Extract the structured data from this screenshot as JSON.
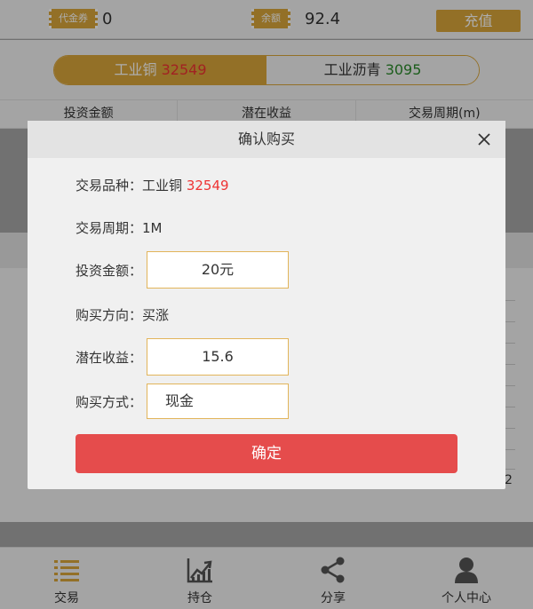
{
  "topbar": {
    "coupon_tag": "代金券",
    "coupon_value": "0",
    "balance_tag": "余额",
    "balance_value": "92.4",
    "recharge_label": "充值"
  },
  "products": [
    {
      "name": "工业铜",
      "price": "32549",
      "active": true
    },
    {
      "name": "工业沥青",
      "price": "3095",
      "active": false
    }
  ],
  "columns": [
    "投资金额",
    "潜在收益",
    "交易周期(m)"
  ],
  "chart_axis_label": "2",
  "modal": {
    "title": "确认购买",
    "close_symbol": "×",
    "product_label": "交易品种：",
    "product_name": "工业铜",
    "product_price": "32549",
    "period_label": "交易周期：",
    "period_value": "1M",
    "amount_label": "投资金额：",
    "amount_value": "20元",
    "direction_label": "购买方向：",
    "direction_value": "买涨",
    "profit_label": "潜在收益：",
    "profit_value": "15.6",
    "method_label": "购买方式：",
    "method_value": "现金",
    "confirm_label": "确定"
  },
  "nav": [
    {
      "label": "交易",
      "icon": "list-icon"
    },
    {
      "label": "持仓",
      "icon": "trend-chart-icon"
    },
    {
      "label": "分享",
      "icon": "share-icon"
    },
    {
      "label": "个人中心",
      "icon": "user-icon"
    }
  ],
  "colors": {
    "accent": "#d9a53a",
    "danger": "#e54c4c",
    "up": "#e33",
    "down": "#2b8a2b"
  }
}
